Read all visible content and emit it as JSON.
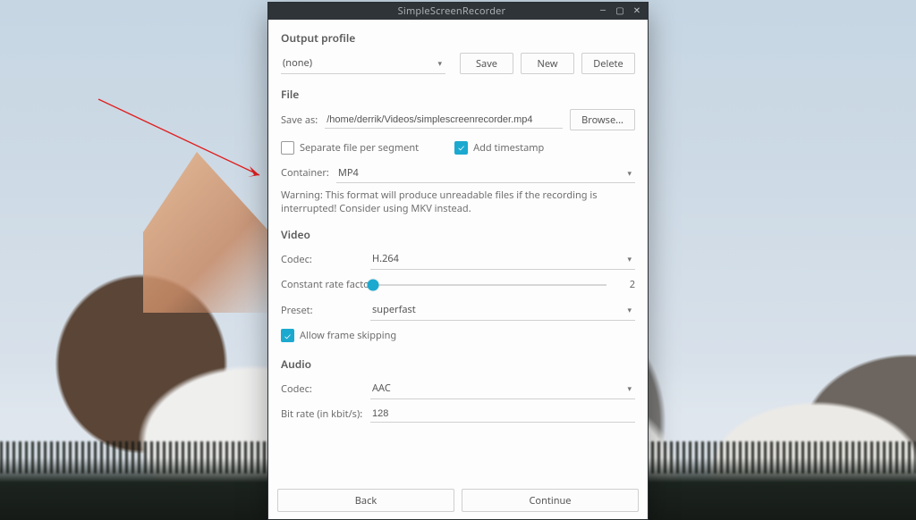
{
  "titlebar": {
    "title": "SimpleScreenRecorder"
  },
  "output_profile": {
    "heading": "Output profile",
    "selected": "(none)",
    "save": "Save",
    "new": "New",
    "delete": "Delete"
  },
  "file": {
    "heading": "File",
    "save_as_label": "Save as:",
    "save_as_value": "/home/derrik/Videos/simplescreenrecorder.mp4",
    "browse": "Browse...",
    "separate_label": "Separate file per segment",
    "separate_checked": false,
    "add_timestamp_label": "Add timestamp",
    "add_timestamp_checked": true,
    "container_label": "Container:",
    "container_value": "MP4",
    "warning": "Warning: This format will produce unreadable files if the recording is interrupted! Consider using MKV instead."
  },
  "video": {
    "heading": "Video",
    "codec_label": "Codec:",
    "codec_value": "H.264",
    "crf_label": "Constant rate factor:",
    "crf_value": "2",
    "preset_label": "Preset:",
    "preset_value": "superfast",
    "allow_skip_label": "Allow frame skipping",
    "allow_skip_checked": true
  },
  "audio": {
    "heading": "Audio",
    "codec_label": "Codec:",
    "codec_value": "AAC",
    "bitrate_label": "Bit rate (in kbit/s):",
    "bitrate_value": "128"
  },
  "footer": {
    "back": "Back",
    "continue": "Continue"
  }
}
